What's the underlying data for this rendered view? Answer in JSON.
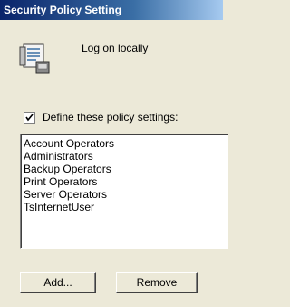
{
  "window": {
    "title": "Security Policy Setting"
  },
  "policy": {
    "icon": "policy-document-icon",
    "name": "Log on locally"
  },
  "define": {
    "checked": true,
    "label": "Define these policy settings:"
  },
  "groups": [
    "Account Operators",
    "Administrators",
    "Backup Operators",
    "Print Operators",
    "Server Operators",
    "TsInternetUser"
  ],
  "buttons": {
    "add_label": "Add...",
    "remove_label": "Remove"
  }
}
